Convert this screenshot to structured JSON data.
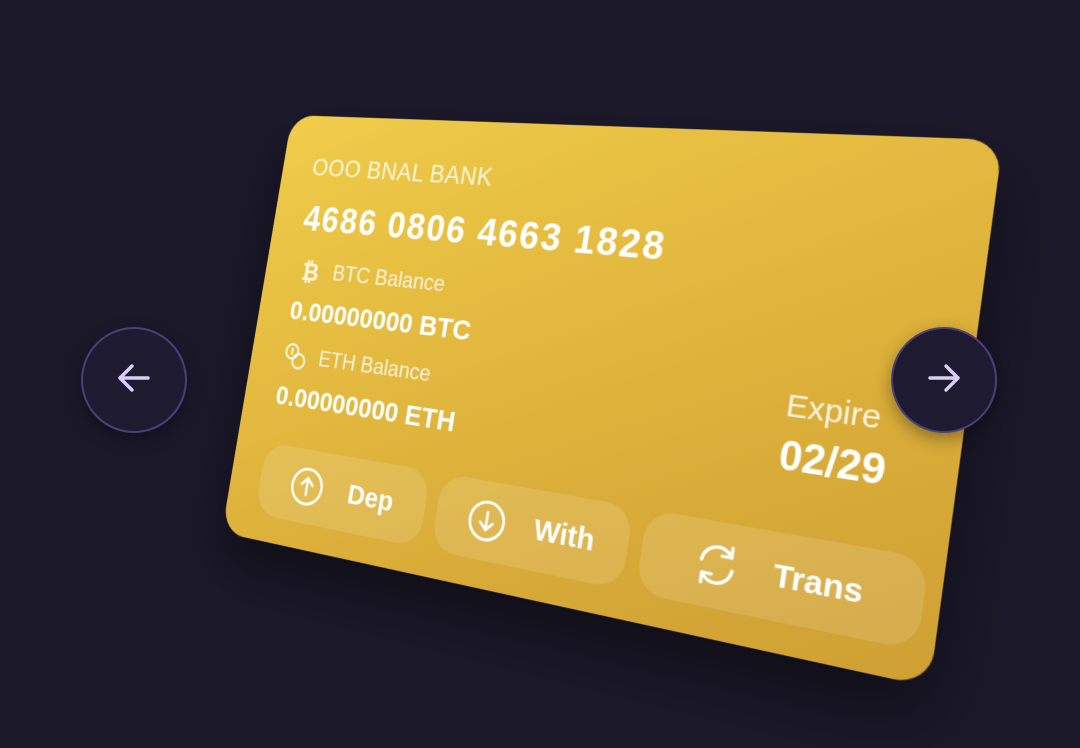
{
  "card": {
    "bank_name": "OOO BNAL BANK",
    "number": "4686 0806 4663 1828",
    "btc": {
      "label": "BTC Balance",
      "value": "0.00000000 BTC",
      "icon": "bitcoin-icon"
    },
    "eth": {
      "label": "ETH Balance",
      "value": "0.00000000 ETH",
      "icon": "coins-icon"
    },
    "expire_label": "Expire",
    "expire_date": "02/29"
  },
  "actions": [
    {
      "label": "Dep",
      "icon": "arrow-up-circle-icon"
    },
    {
      "label": "With",
      "icon": "arrow-down-circle-icon"
    },
    {
      "label": "Trans",
      "icon": "refresh-icon"
    }
  ],
  "nav": {
    "prev_icon": "arrow-left-icon",
    "next_icon": "arrow-right-icon"
  },
  "colors": {
    "background": "#1b1829",
    "card_gold": "#e2b83e",
    "nav_border": "#4a3f78",
    "nav_arrow": "#d8cff7"
  }
}
